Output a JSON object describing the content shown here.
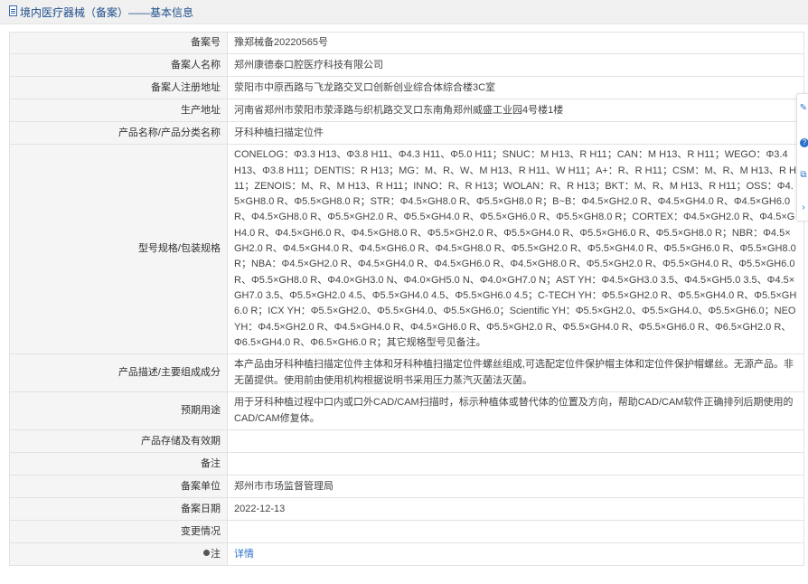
{
  "header": {
    "title": "境内医疗器械（备案）——基本信息"
  },
  "rows": [
    {
      "label": "备案号",
      "value": "豫郑械备20220565号"
    },
    {
      "label": "备案人名称",
      "value": "郑州康德泰口腔医疗科技有限公司"
    },
    {
      "label": "备案人注册地址",
      "value": "荥阳市中原西路与飞龙路交叉口创新创业综合体综合楼3C室"
    },
    {
      "label": "生产地址",
      "value": "河南省郑州市荥阳市荥泽路与织机路交叉口东南角郑州威盛工业园4号楼1楼"
    },
    {
      "label": "产品名称/产品分类名称",
      "value": "牙科种植扫描定位件"
    },
    {
      "label": "型号规格/包装规格",
      "value": "CONELOG：Φ3.3 H13、Φ3.8 H11、Φ4.3 H11、Φ5.0 H11；SNUC：M H13、R H11；CAN：M H13、R H11；WEGO：Φ3.4 H13、Φ3.8 H11；DENTIS：R H13；MG：M、R、W、M H13、R H11、W H11；A+：R、R H11；CSM：M、R、M H13、R H11；ZENOIS：M、R、M H13、R H11；INNO：R、R H13；WOLAN：R、R H13；BKT：M、R、M H13、R H11；OSS：Φ4.5×GH8.0 R、Φ5.5×GH8.0 R；STR：Φ4.5×GH8.0 R、Φ5.5×GH8.0 R；B~B：Φ4.5×GH2.0 R、Φ4.5×GH4.0 R、Φ4.5×GH6.0 R、Φ4.5×GH8.0 R、Φ5.5×GH2.0 R、Φ5.5×GH4.0 R、Φ5.5×GH6.0 R、Φ5.5×GH8.0 R；CORTEX：Φ4.5×GH2.0 R、Φ4.5×GH4.0 R、Φ4.5×GH6.0 R、Φ4.5×GH8.0 R、Φ5.5×GH2.0 R、Φ5.5×GH4.0 R、Φ5.5×GH6.0 R、Φ5.5×GH8.0 R；NBR：Φ4.5×GH2.0 R、Φ4.5×GH4.0 R、Φ4.5×GH6.0 R、Φ4.5×GH8.0 R、Φ5.5×GH2.0 R、Φ5.5×GH4.0 R、Φ5.5×GH6.0 R、Φ5.5×GH8.0 R；NBA：Φ4.5×GH2.0 R、Φ4.5×GH4.0 R、Φ4.5×GH6.0 R、Φ4.5×GH8.0 R、Φ5.5×GH2.0 R、Φ5.5×GH4.0 R、Φ5.5×GH6.0 R、Φ5.5×GH8.0 R、Φ4.0×GH3.0 N、Φ4.0×GH5.0 N、Φ4.0×GH7.0 N；AST YH：Φ4.5×GH3.0 3.5、Φ4.5×GH5.0 3.5、Φ4.5×GH7.0 3.5、Φ5.5×GH2.0 4.5、Φ5.5×GH4.0 4.5、Φ5.5×GH6.0 4.5；C-TECH YH：Φ5.5×GH2.0 R、Φ5.5×GH4.0 R、Φ5.5×GH6.0 R；ICX YH：Φ5.5×GH2.0、Φ5.5×GH4.0、Φ5.5×GH6.0；Scientific YH：Φ5.5×GH2.0、Φ5.5×GH4.0、Φ5.5×GH6.0；NEO YH：Φ4.5×GH2.0 R、Φ4.5×GH4.0 R、Φ4.5×GH6.0 R、Φ5.5×GH2.0 R、Φ5.5×GH4.0 R、Φ5.5×GH6.0 R、Φ6.5×GH2.0 R、Φ6.5×GH4.0 R、Φ6.5×GH6.0 R；其它规格型号见备注。"
    },
    {
      "label": "产品描述/主要组成成分",
      "value": "本产品由牙科种植扫描定位件主体和牙科种植扫描定位件螺丝组成,可选配定位件保护帽主体和定位件保护帽螺丝。无源产品。非无菌提供。使用前由使用机构根据说明书采用压力蒸汽灭菌法灭菌。"
    },
    {
      "label": "预期用途",
      "value": "用于牙科种植过程中口内或口外CAD/CAM扫描时，标示种植体或替代体的位置及方向，帮助CAD/CAM软件正确排列后期使用的CAD/CAM修复体。"
    },
    {
      "label": "产品存储及有效期",
      "value": ""
    },
    {
      "label": "备注",
      "value": ""
    },
    {
      "label": "备案单位",
      "value": "郑州市市场监督管理局"
    },
    {
      "label": "备案日期",
      "value": "2022-12-13"
    },
    {
      "label": "变更情况",
      "value": ""
    },
    {
      "label": "注",
      "value": "详情"
    }
  ],
  "side_rail": {
    "icons": [
      "edit-icon",
      "help-icon",
      "copy-icon",
      "close-icon"
    ]
  }
}
